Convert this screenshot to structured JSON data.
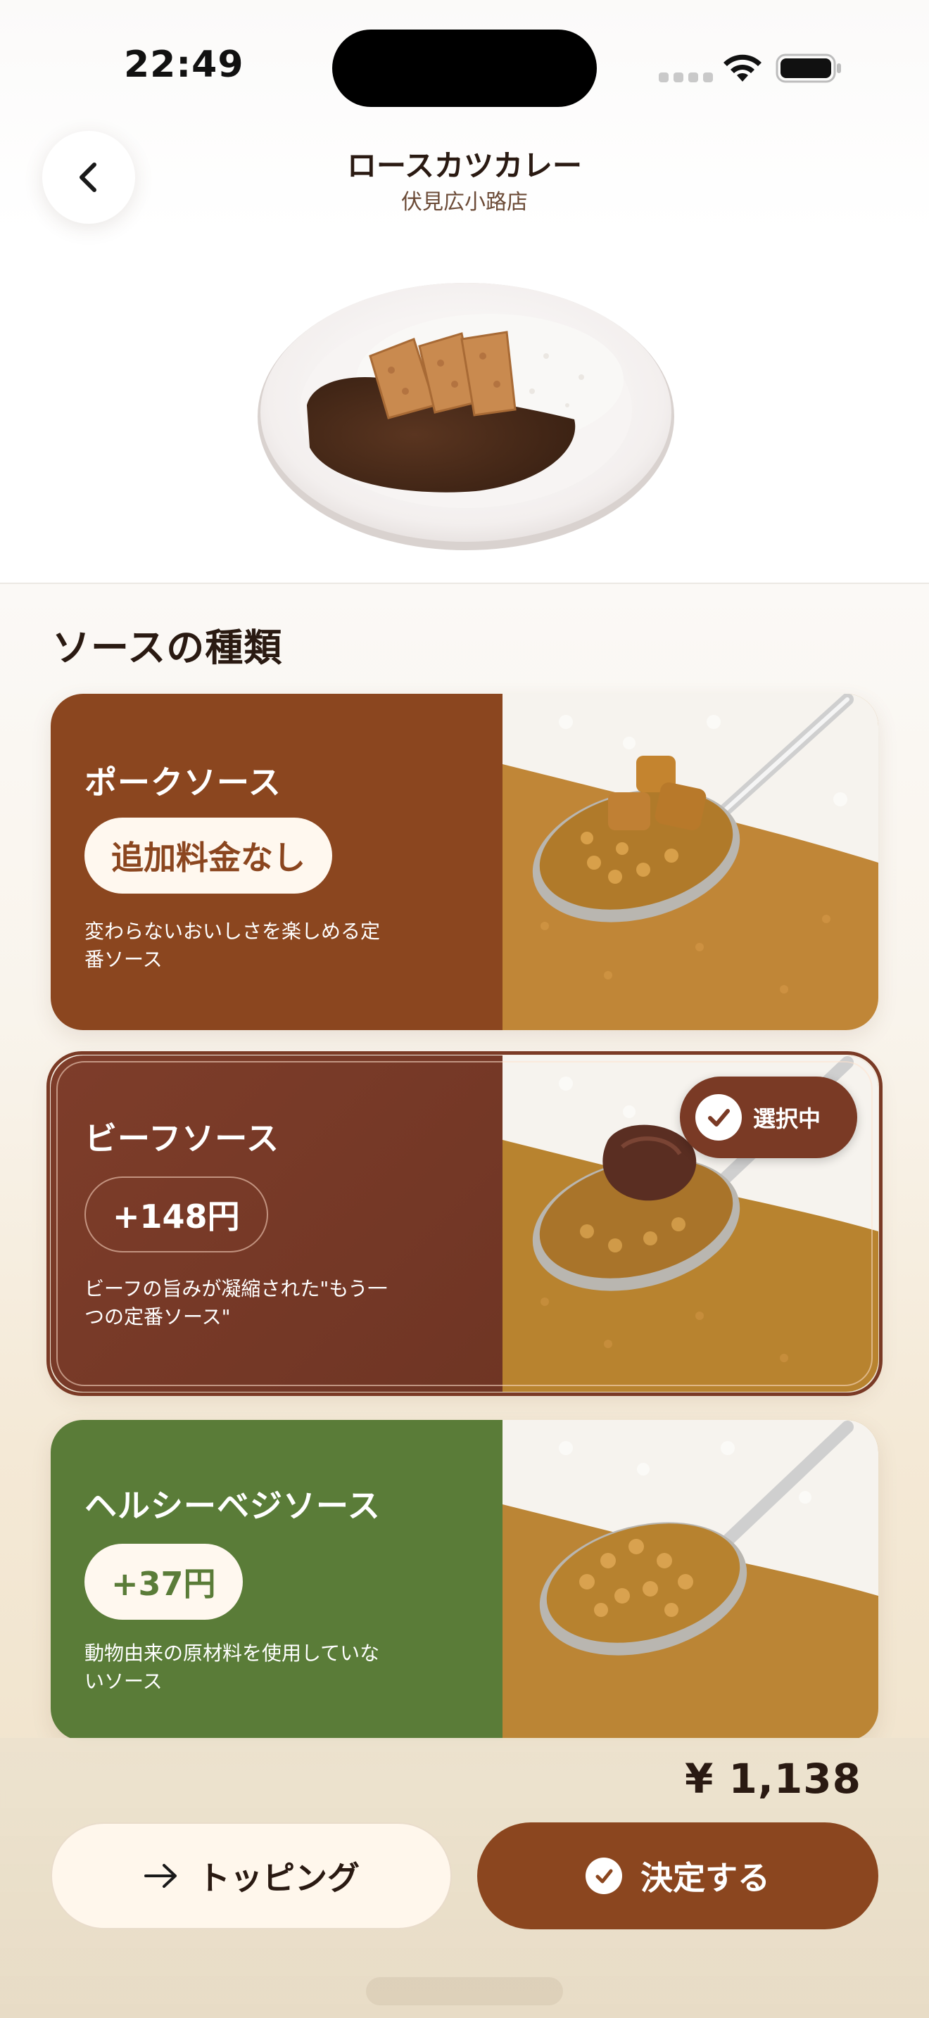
{
  "status_bar": {
    "time": "22:49"
  },
  "header": {
    "title": "ロースカツカレー",
    "subtitle": "伏見広小路店"
  },
  "section": {
    "title": "ソースの種類"
  },
  "options": [
    {
      "name": "ポークソース",
      "price": "追加料金なし",
      "description": "変わらないおいしさを楽しめる定番ソース",
      "color": "#8b461f",
      "selected": false
    },
    {
      "name": "ビーフソース",
      "price": "+148円",
      "description": "ビーフの旨みが凝縮された\"もう一つの定番ソース\"",
      "color": "#7a3a25",
      "selected": true
    },
    {
      "name": "ヘルシーベジソース",
      "price": "+37円",
      "description": "動物由来の原材料を使用していないソース",
      "color": "#5a7c38",
      "selected": false
    }
  ],
  "selected_badge": "選択中",
  "footer": {
    "total": "¥ 1,138",
    "topping_label": "トッピング",
    "confirm_label": "決定する"
  },
  "icons": {
    "back": "chevron-left-icon",
    "topping": "arrow-right-icon",
    "confirm": "check-circle-icon",
    "selected": "check-circle-icon"
  },
  "colors": {
    "accent": "#8b461f",
    "beef": "#7a3a25",
    "veg": "#5a7c38",
    "cream": "#fff8ef"
  }
}
